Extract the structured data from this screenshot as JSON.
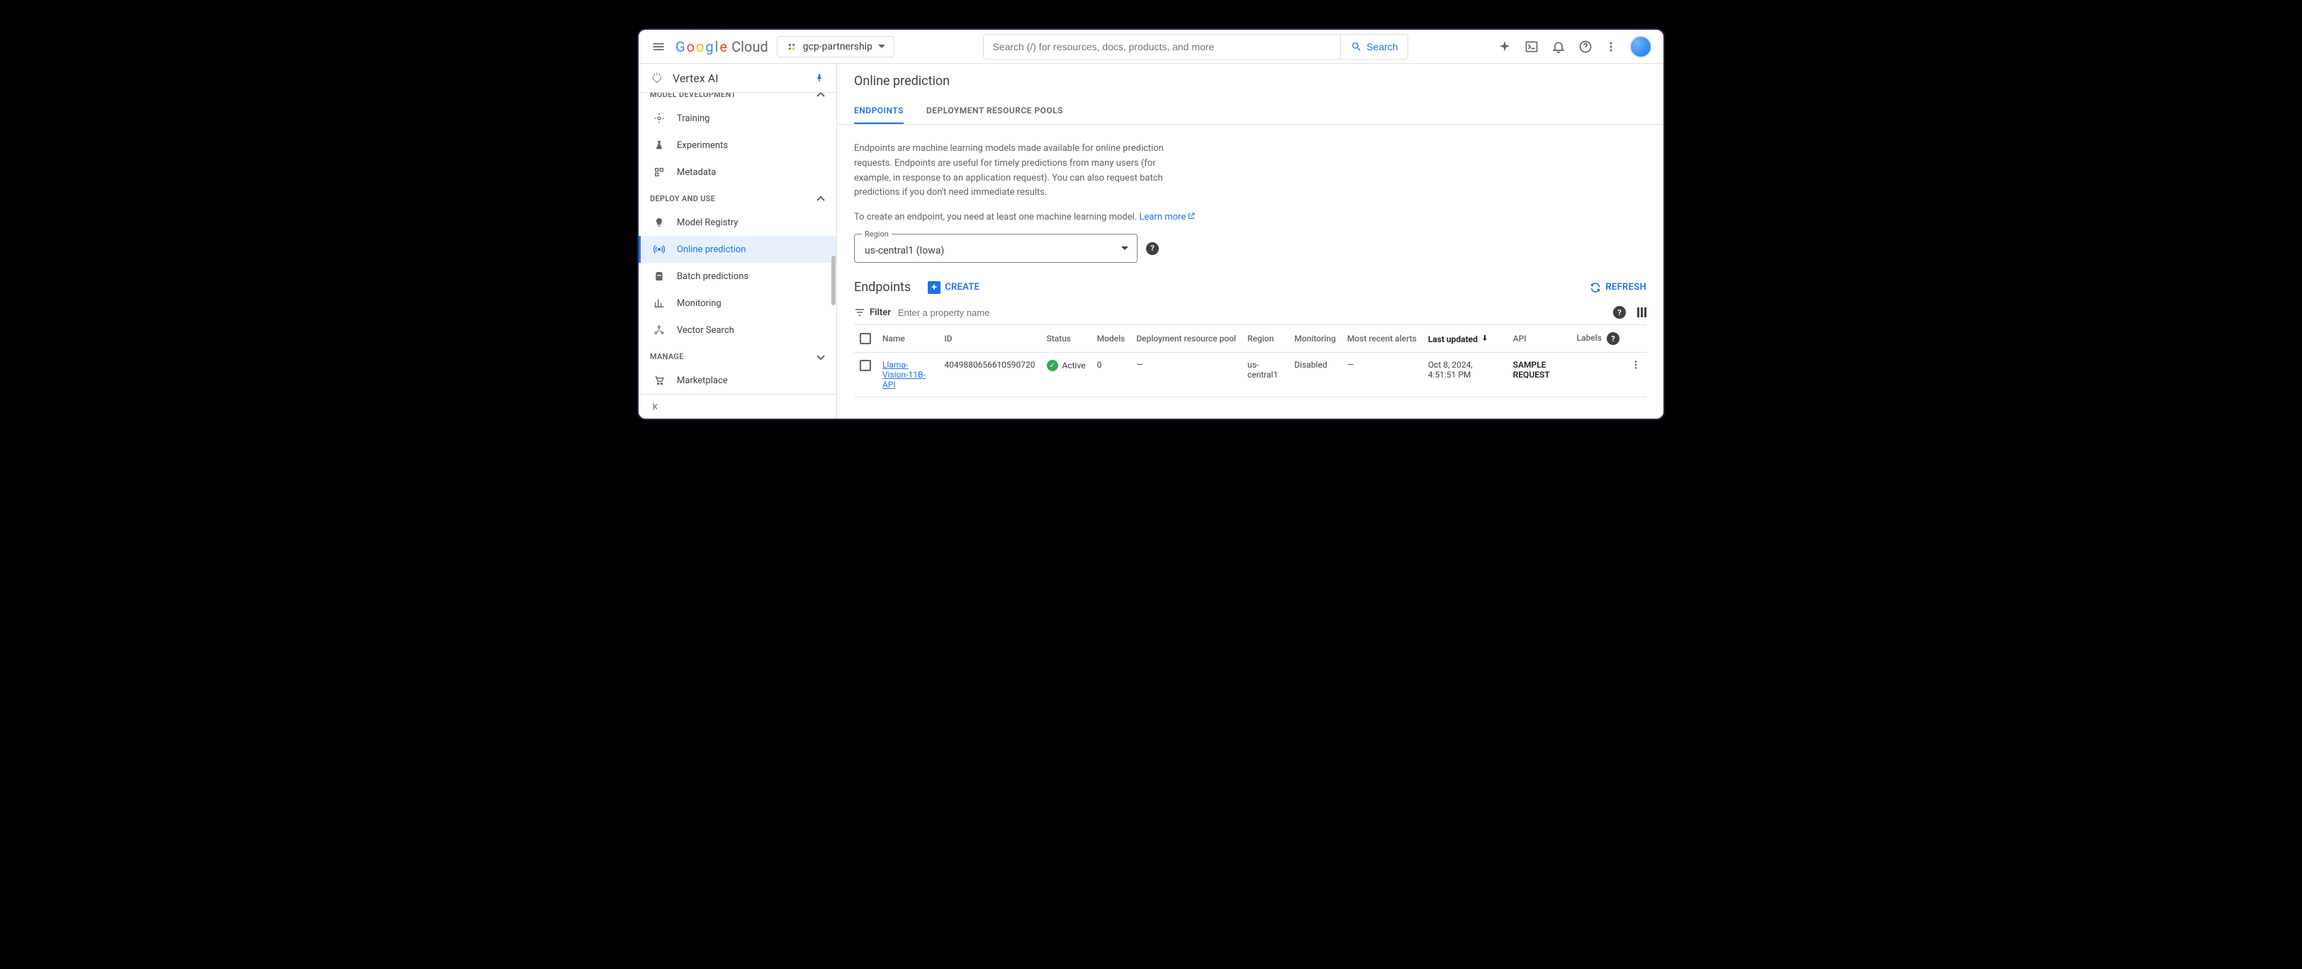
{
  "header": {
    "logo_cloud": "Cloud",
    "project_name": "gcp-partnership",
    "search_placeholder": "Search (/) for resources, docs, products, and more",
    "search_button": "Search"
  },
  "sidebar": {
    "product_title": "Vertex AI",
    "group_truncated": "MODEL DEVELOPMENT",
    "items_a": [
      {
        "label": "Training"
      },
      {
        "label": "Experiments"
      },
      {
        "label": "Metadata"
      }
    ],
    "group_deploy": "DEPLOY AND USE",
    "items_b": [
      {
        "label": "Model Registry"
      },
      {
        "label": "Online prediction"
      },
      {
        "label": "Batch predictions"
      },
      {
        "label": "Monitoring"
      },
      {
        "label": "Vector Search"
      }
    ],
    "group_manage": "MANAGE",
    "items_c": [
      {
        "label": "Marketplace"
      }
    ]
  },
  "main": {
    "title": "Online prediction",
    "tabs": [
      {
        "label": "ENDPOINTS"
      },
      {
        "label": "DEPLOYMENT RESOURCE POOLS"
      }
    ],
    "description": "Endpoints are machine learning models made available for online prediction requests. Endpoints are useful for timely predictions from many users (for example, in response to an application request). You can also request batch predictions if you don't need immediate results.",
    "create_hint": "To create an endpoint, you need at least one machine learning model. ",
    "learn_more": "Learn more",
    "region_label": "Region",
    "region_value": "us-central1 (Iowa)",
    "section_title": "Endpoints",
    "create_button": "CREATE",
    "refresh_button": "REFRESH",
    "filter_label": "Filter",
    "filter_placeholder": "Enter a property name",
    "columns": {
      "name": "Name",
      "id": "ID",
      "status": "Status",
      "models": "Models",
      "pool": "Deployment resource pool",
      "region": "Region",
      "monitoring": "Monitoring",
      "alerts": "Most recent alerts",
      "updated": "Last updated",
      "api": "API",
      "labels": "Labels"
    },
    "rows": [
      {
        "name": "Llama-Vision-11B-API",
        "id": "4049880656610590720",
        "status": "Active",
        "models": "0",
        "pool": "—",
        "region": "us-central1",
        "monitoring": "Disabled",
        "alerts": "—",
        "updated": "Oct 8, 2024, 4:51:51 PM",
        "api": "SAMPLE REQUEST"
      }
    ]
  }
}
